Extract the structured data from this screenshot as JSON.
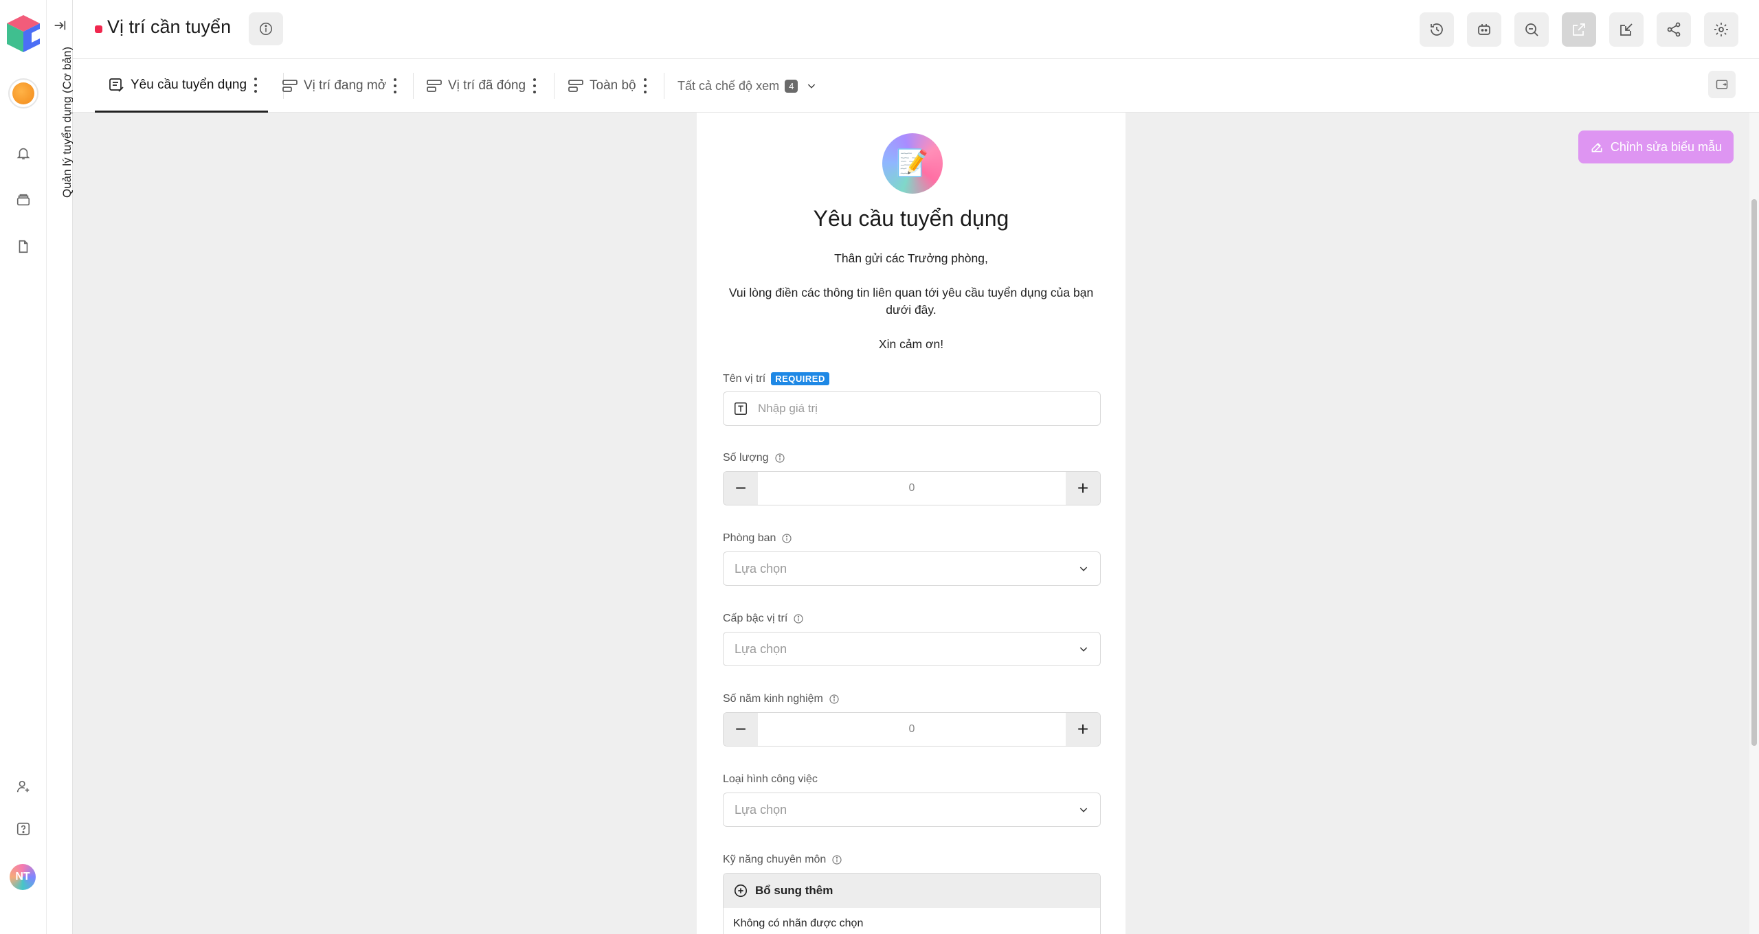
{
  "rail": {
    "vertical_title": "Quản lý tuyển dụng (Cơ bản)",
    "avatar_initials": "NT",
    "icons": [
      "bell-icon",
      "inbox-icon",
      "document-icon",
      "add-user-icon",
      "help-icon"
    ]
  },
  "header": {
    "title": "Vị trí cần tuyển",
    "status_color": "#f0274e",
    "toolbar_icons": [
      "history-icon",
      "bot-icon",
      "search-zoom-icon",
      "export-icon",
      "import-icon",
      "share-icon",
      "settings-icon"
    ]
  },
  "tabs": {
    "items": [
      {
        "label": "Yêu cầu tuyển dụng",
        "active": true
      },
      {
        "label": "Vị trí đang mở",
        "active": false
      },
      {
        "label": "Vị trí đã đóng",
        "active": false
      },
      {
        "label": "Toàn bộ",
        "active": false
      }
    ],
    "views_label": "Tất cả chế độ xem",
    "views_count": "4"
  },
  "main": {
    "edit_form_label": "Chỉnh sửa biểu mẫu",
    "accent_color": "#de95f2"
  },
  "form": {
    "icon_emoji": "📝",
    "title": "Yêu cầu tuyển dụng",
    "greeting": "Thân gửi các Trưởng phòng,",
    "instruction": "Vui lòng điền các thông tin liên quan tới yêu cầu tuyển dụng của bạn dưới đây.",
    "thanks": "Xin cảm ơn!",
    "required_badge": "REQUIRED",
    "fields": {
      "position_name": {
        "label": "Tên vị trí",
        "placeholder": "Nhập giá trị"
      },
      "quantity": {
        "label": "Số lượng",
        "value": "0"
      },
      "department": {
        "label": "Phòng ban",
        "placeholder": "Lựa chọn"
      },
      "level": {
        "label": "Cấp bậc vị trí",
        "placeholder": "Lựa chọn"
      },
      "experience": {
        "label": "Số năm kinh nghiệm",
        "value": "0"
      },
      "job_type": {
        "label": "Loại hình công việc",
        "placeholder": "Lựa chọn"
      },
      "skills": {
        "label": "Kỹ năng chuyên môn",
        "add_label": "Bổ sung thêm",
        "empty_text": "Không có nhãn được chọn"
      }
    }
  }
}
